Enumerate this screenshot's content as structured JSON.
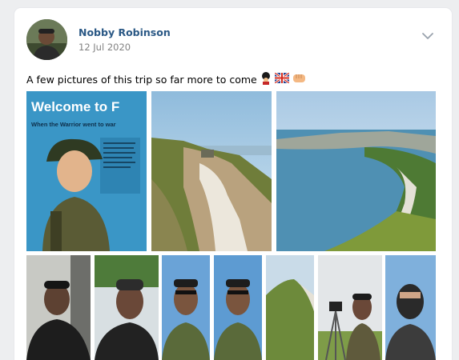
{
  "post": {
    "author": "Nobby Robinson",
    "date": "12 Jul 2020",
    "text": "A few pictures of this trip so far more to come",
    "emojis": [
      "guardsman-emoji",
      "uk-flag-emoji",
      "fist-bump-emoji"
    ]
  },
  "photos": {
    "large": [
      {
        "name": "photo-welcome-sign-soldier",
        "sign_text": "Welcome to F",
        "sign_sub": "When the Warrior went to war"
      },
      {
        "name": "photo-cliff-bunker"
      },
      {
        "name": "photo-coastal-bay-view"
      }
    ],
    "small": [
      {
        "name": "photo-selfie-car"
      },
      {
        "name": "photo-selfie-trees"
      },
      {
        "name": "photo-selfie-sky-1"
      },
      {
        "name": "photo-selfie-sky-2"
      },
      {
        "name": "photo-grassy-cliff"
      },
      {
        "name": "photo-camera-tripod"
      },
      {
        "name": "photo-selfie-balaclava"
      }
    ]
  },
  "colors": {
    "link": "#2a5885",
    "muted": "#828282",
    "background": "#edeef0",
    "card": "#ffffff"
  }
}
